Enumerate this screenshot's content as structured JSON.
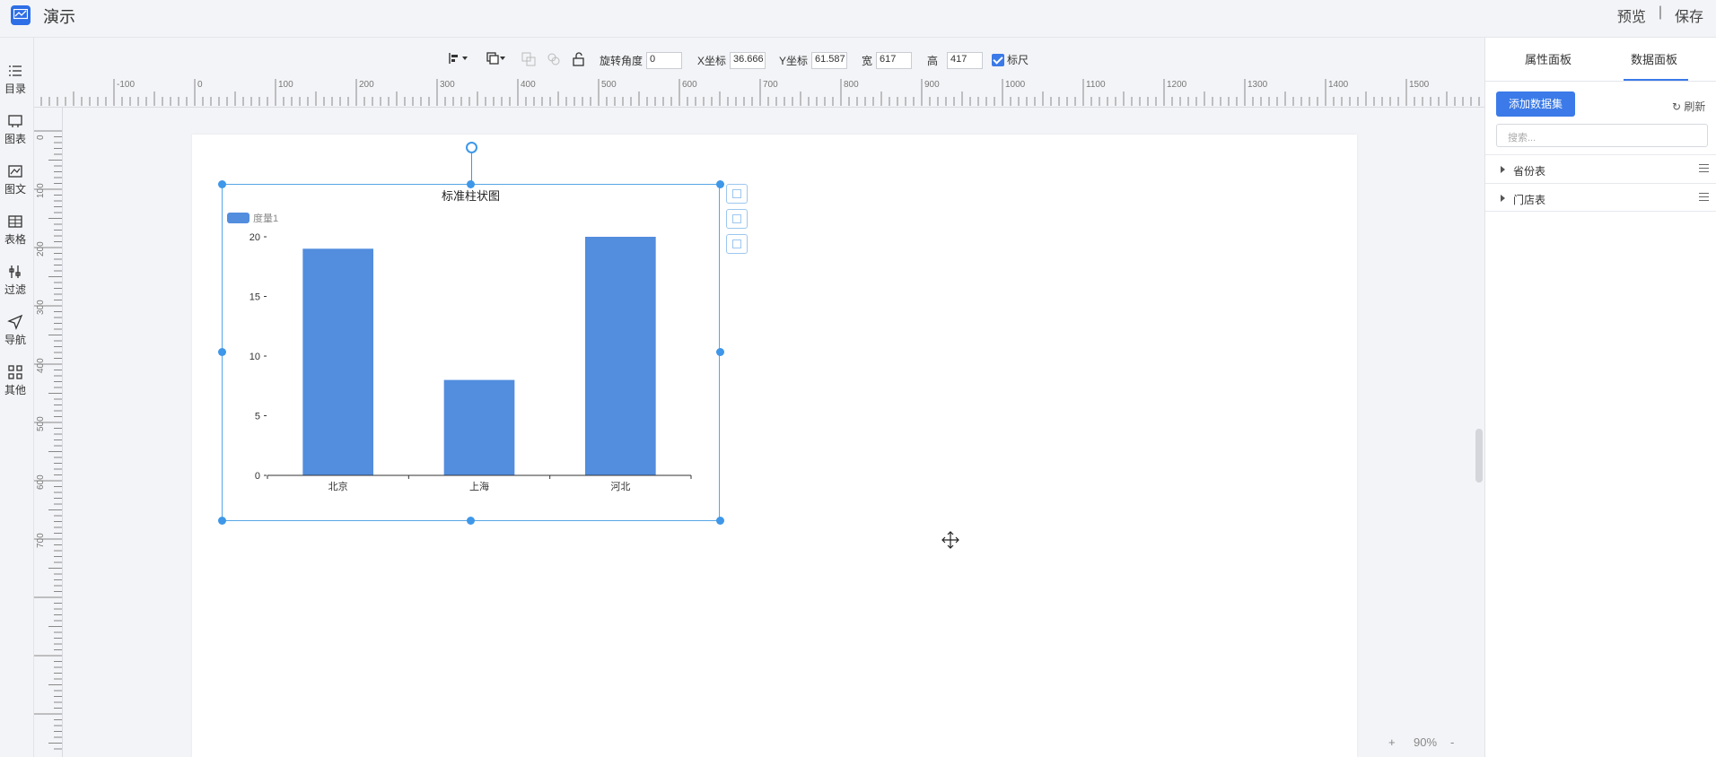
{
  "app": {
    "title": "演示",
    "preview_label": "预览",
    "divider": "|",
    "save_label": "保存"
  },
  "leftbar": {
    "items": [
      {
        "label": "目录",
        "icon": "list-icon"
      },
      {
        "label": "图表",
        "icon": "chart-icon"
      },
      {
        "label": "图文",
        "icon": "image-text-icon"
      },
      {
        "label": "表格",
        "icon": "table-icon"
      },
      {
        "label": "过滤",
        "icon": "filter-icon"
      },
      {
        "label": "导航",
        "icon": "navigate-icon"
      },
      {
        "label": "其他",
        "icon": "grid-icon"
      }
    ]
  },
  "toolbar": {
    "rotation_label": "旋转角度",
    "rotation_value": "0",
    "x_label": "X坐标",
    "x_value": "36.666",
    "y_label": "Y坐标",
    "y_value": "61.587",
    "width_label": "宽",
    "width_value": "617",
    "height_label": "高",
    "height_value": "417",
    "ruler_label": "标尺",
    "ruler_checked": true
  },
  "rulers": {
    "h_labels": [
      "-100",
      "0",
      "100",
      "200",
      "300",
      "400",
      "500",
      "600",
      "700",
      "800",
      "900",
      "1000",
      "1100",
      "1200",
      "1300",
      "1400",
      "1500"
    ],
    "v_labels": [
      "0",
      "100",
      "200",
      "300",
      "400",
      "500",
      "600",
      "700"
    ]
  },
  "chart_data": {
    "type": "bar",
    "title": "标准柱状图",
    "categories": [
      "北京",
      "上海",
      "河北"
    ],
    "series": [
      {
        "name": "度量1",
        "values": [
          19,
          8,
          20
        ],
        "color": "#528dde"
      }
    ],
    "ylim": [
      0,
      20
    ],
    "yticks": [
      "0",
      "5",
      "10",
      "15",
      "20"
    ],
    "legend": "top-left",
    "grid": false
  },
  "rightpanel": {
    "tabs": [
      {
        "label": "属性面板",
        "active": false
      },
      {
        "label": "数据面板",
        "active": true
      }
    ],
    "add_dataset_label": "添加数据集",
    "refresh_label": "刷新",
    "search_placeholder": "搜索...",
    "datasets": [
      {
        "name": "省份表"
      },
      {
        "name": "门店表"
      }
    ]
  },
  "zoom": {
    "plus": "+",
    "value": "90%",
    "minus": "-"
  },
  "colors": {
    "accent": "#3b7ae8",
    "bar": "#528dde",
    "selection": "#3e97e8"
  }
}
